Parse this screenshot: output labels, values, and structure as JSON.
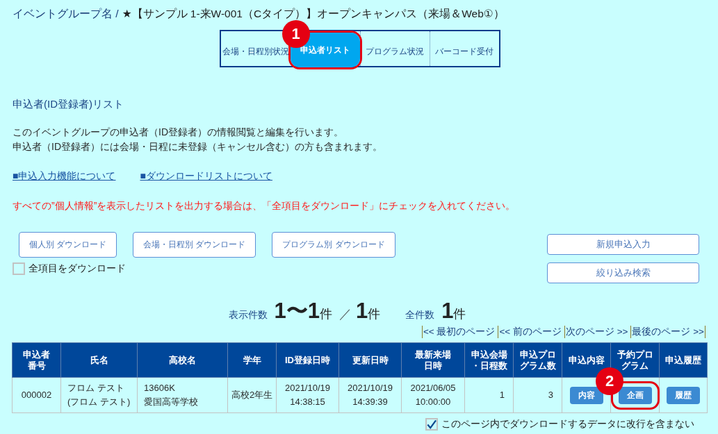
{
  "header": {
    "group_label": "イベントグループ名 /",
    "event_name": "★【サンプル 1-来W-001（Cタイプ）】オープンキャンパス（来場＆Web①）"
  },
  "tabs": [
    {
      "label": "会場・日程別状況",
      "selected": false
    },
    {
      "label": "申込者リスト",
      "selected": true,
      "callout": "1"
    },
    {
      "label": "プログラム状況",
      "selected": false
    },
    {
      "label": "バーコード受付",
      "selected": false
    }
  ],
  "section_title": "申込者(ID登録者)リスト",
  "description": [
    "このイベントグループの申込者（ID登録者）の情報閲覧と編集を行います。",
    "申込者（ID登録者）には会場・日程に未登録（キャンセル含む）の方も含まれます。"
  ],
  "links": [
    "■申込入力機能について",
    "■ダウンロードリストについて"
  ],
  "notice": "すべての”個人情報”を表示したリストを出力する場合は、「全項目をダウンロード」にチェックを入れてください。",
  "download_buttons": [
    "個人別 ダウンロード",
    "会場・日程別 ダウンロード",
    "プログラム別 ダウンロード"
  ],
  "download_all": {
    "label": "全項目をダウンロード",
    "checked": false
  },
  "action_buttons": [
    "新規申込入力",
    "絞り込み検索"
  ],
  "summary": {
    "shown_label": "表示件数",
    "shown_range": "1〜1",
    "shown_range_unit": "件",
    "separator": "／",
    "shown_total": "1",
    "shown_total_unit": "件",
    "total_label": "全件数",
    "total": "1",
    "total_unit": "件"
  },
  "pagination": [
    "<< 最初のページ",
    "<< 前のページ",
    "次のページ >>",
    "最後のページ >>"
  ],
  "table": {
    "columns": [
      "申込者番号",
      "氏名",
      "高校名",
      "学年",
      "ID登録日時",
      "更新日時",
      "最新来場日時",
      "申込会場・日程数",
      "申込プログラム数",
      "申込内容",
      "予約プログラム",
      "申込履歴"
    ],
    "rows": [
      {
        "cells": [
          {
            "kind": "text",
            "text": "000002"
          },
          {
            "kind": "text",
            "text": "フロム テスト\n(フロム テスト)"
          },
          {
            "kind": "text",
            "text": "13606K\n愛国高等学校"
          },
          {
            "kind": "text",
            "text": "高校2年生"
          },
          {
            "kind": "text",
            "text": "2021/10/19\n14:38:15"
          },
          {
            "kind": "text",
            "text": "2021/10/19\n14:39:39"
          },
          {
            "kind": "text",
            "text": "2021/06/05\n10:00:00"
          },
          {
            "kind": "text",
            "text": "1"
          },
          {
            "kind": "text",
            "text": "3"
          },
          {
            "kind": "button",
            "text": "内容"
          },
          {
            "kind": "button",
            "text": "企画",
            "callout": "2"
          },
          {
            "kind": "button",
            "text": "履歴"
          }
        ]
      }
    ]
  },
  "no_line_breaks": {
    "label": "このページ内でダウンロードするデータに改行を含まない",
    "checked": true
  }
}
